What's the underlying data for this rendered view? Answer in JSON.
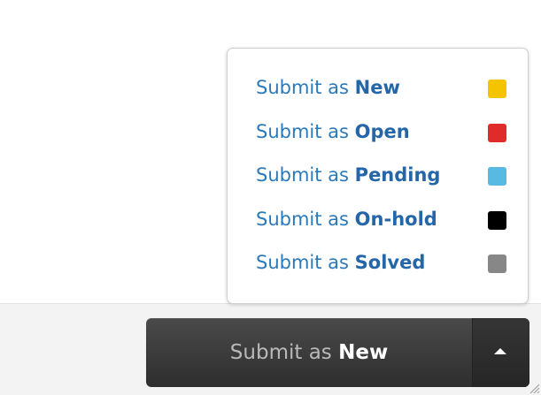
{
  "menu": {
    "items": [
      {
        "prefix": "Submit as",
        "status": "New",
        "color": "#f5c400"
      },
      {
        "prefix": "Submit as",
        "status": "Open",
        "color": "#e02b2b"
      },
      {
        "prefix": "Submit as",
        "status": "Pending",
        "color": "#58b9e3"
      },
      {
        "prefix": "Submit as",
        "status": "On-hold",
        "color": "#000000"
      },
      {
        "prefix": "Submit as",
        "status": "Solved",
        "color": "#878787"
      }
    ]
  },
  "submit_button": {
    "prefix": "Submit as",
    "status": "New"
  },
  "icons": {
    "toggle": "caret-up-icon",
    "corner": "resize-grip-icon"
  }
}
